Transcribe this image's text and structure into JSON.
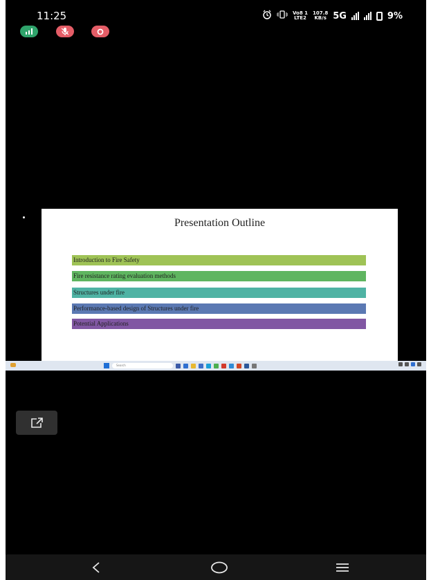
{
  "status_bar": {
    "time": "11:25",
    "volte_top": "Vo8 1",
    "volte_bottom": "LTE2",
    "speed_top": "107.8",
    "speed_bottom": "KB/s",
    "network": "5G",
    "battery": "9%",
    "icons": [
      "alarm-icon",
      "vibrate-icon",
      "signal-icon",
      "battery-icon"
    ]
  },
  "floating_controls": [
    "signal-stats-icon",
    "mute-mic-icon",
    "record-icon"
  ],
  "slide": {
    "title": "Presentation Outline",
    "items": [
      {
        "label": "Introduction to Fire Safety",
        "color": "#9fc356"
      },
      {
        "label": "Fire resistance rating evaluation methods",
        "color": "#5fb560"
      },
      {
        "label": "Structures under fire",
        "color": "#4fb3a4"
      },
      {
        "label": "Performance-based design of Structures under fire",
        "color": "#5b79b3"
      },
      {
        "label": "Potential Applications",
        "color": "#8157a3"
      }
    ]
  },
  "taskbar": {
    "weather_text": "",
    "search_placeholder": "Search",
    "clock_time": "",
    "clock_date": ""
  },
  "pip_button": {
    "icon": "open-external-icon"
  },
  "nav_bar": {
    "icons": [
      "back-icon",
      "home-icon",
      "menu-icon"
    ]
  },
  "colors": {
    "background": "#000000",
    "green_pill": "#2fa36b",
    "red_pill": "#e45d67",
    "nav_bar": "#161616"
  }
}
